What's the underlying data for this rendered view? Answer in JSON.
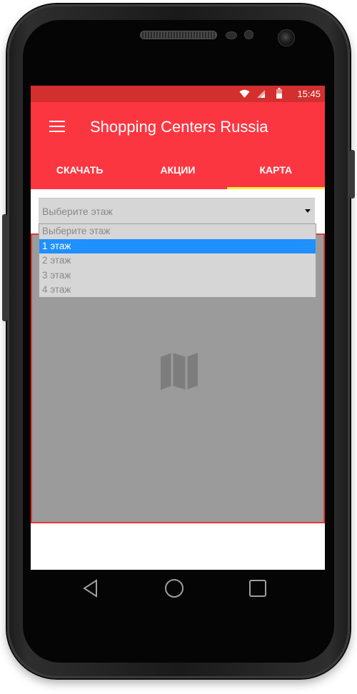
{
  "status_bar": {
    "time": "15:45"
  },
  "app_bar": {
    "title": "Shopping Centers Russia"
  },
  "tabs": [
    {
      "label": "СКАЧАТЬ"
    },
    {
      "label": "АКЦИИ"
    },
    {
      "label": "КАРТА",
      "active": true
    }
  ],
  "floor_select": {
    "selected": "Выберите этаж",
    "options": [
      "Выберите этаж",
      "1 этаж",
      "2 этаж",
      "3 этаж",
      "4 этаж"
    ],
    "highlighted": "1 этаж"
  },
  "colors": {
    "status_bar": "#d32f2f",
    "app_bar": "#fc3641",
    "tab_indicator": "#ffeb3b",
    "map_border": "#e53935",
    "map_background": "#9b9b9b",
    "highlight": "#1e90ff"
  },
  "icons": [
    "menu-icon",
    "wifi-icon",
    "signal-icon",
    "battery-icon",
    "map-icon",
    "back-icon",
    "home-icon",
    "recents-icon"
  ]
}
